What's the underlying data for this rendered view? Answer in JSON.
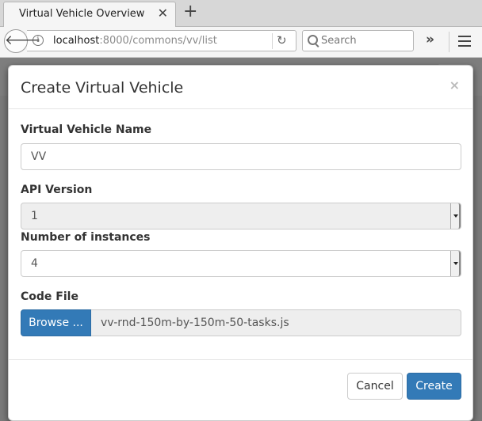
{
  "browser": {
    "tab_title": "Virtual Vehicle Overview",
    "url_host": "localhost",
    "url_rest": ":8000/commons/vv/list",
    "search_placeholder": "Search"
  },
  "modal": {
    "title": "Create Virtual Vehicle",
    "close_symbol": "×",
    "name_label": "Virtual Vehicle Name",
    "name_value": "VV",
    "api_label": "API Version",
    "api_value": "1",
    "instances_label": "Number of instances",
    "instances_value": "4",
    "codefile_label": "Code File",
    "browse_label": "Browse ...",
    "file_name": "vv-rnd-150m-by-150m-50-tasks.js",
    "cancel_label": "Cancel",
    "create_label": "Create"
  },
  "colors": {
    "primary": "#337ab7",
    "backdrop": "#7a7a7a"
  },
  "icons": [
    "close-icon",
    "new-tab-icon",
    "back-arrow-icon",
    "info-icon",
    "reload-icon",
    "search-icon",
    "overflow-chevrons-icon",
    "hamburger-menu-icon",
    "dropdown-arrow-icon"
  ]
}
